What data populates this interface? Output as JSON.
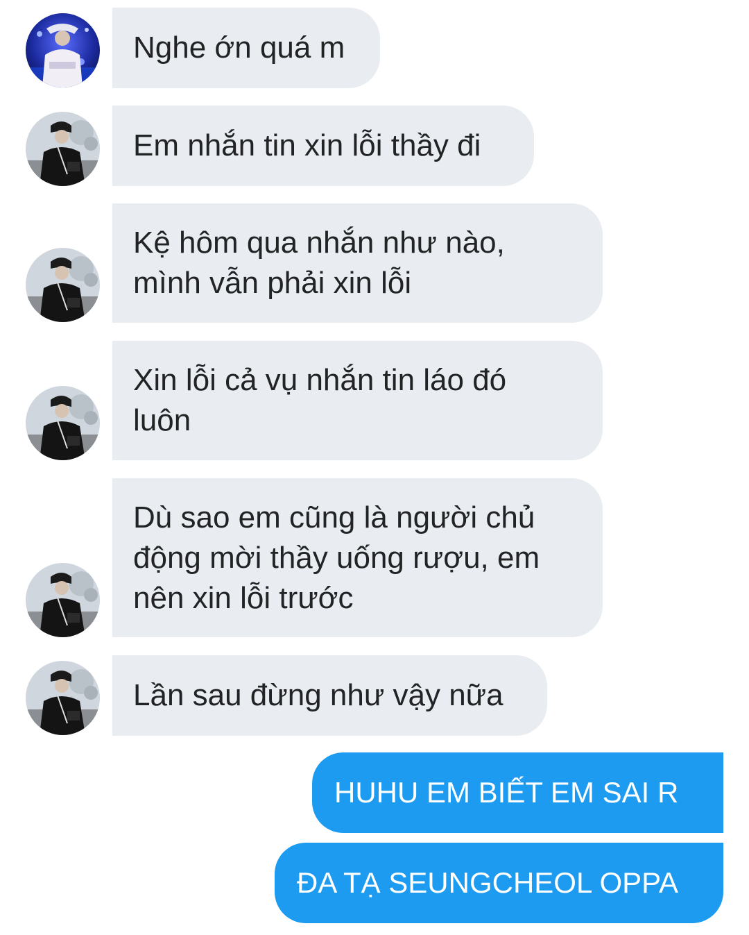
{
  "conversation": {
    "incoming": [
      {
        "text": "Nghe ớn quá m",
        "avatar": "avatar-icon-street-style"
      },
      {
        "text": "Em nhắn tin xin lỗi thầy đi",
        "avatar": "avatar-icon-black-coat"
      },
      {
        "text": "Kệ hôm qua nhắn như nào,\nmình vẫn phải xin lỗi",
        "avatar": "avatar-icon-black-coat"
      },
      {
        "text": "Xin lỗi cả vụ nhắn tin láo đó\nluôn",
        "avatar": "avatar-icon-black-coat"
      },
      {
        "text": "Dù sao em cũng là người chủ\nđộng mời thầy uống rượu, em\nnên xin lỗi trước",
        "avatar": "avatar-icon-black-coat"
      },
      {
        "text": "Lần sau đừng như vậy nữa",
        "avatar": "avatar-icon-black-coat"
      }
    ],
    "outgoing": [
      {
        "text": "HUHU EM BIẾT EM SAI R"
      },
      {
        "text": "ĐA TẠ SEUNGCHEOL OPPA"
      }
    ]
  },
  "colors": {
    "incoming_bubble": "#e9ecf0",
    "incoming_text": "#222325",
    "outgoing_bubble": "#1d9bf0",
    "outgoing_text": "#ffffff",
    "background": "#ffffff"
  }
}
